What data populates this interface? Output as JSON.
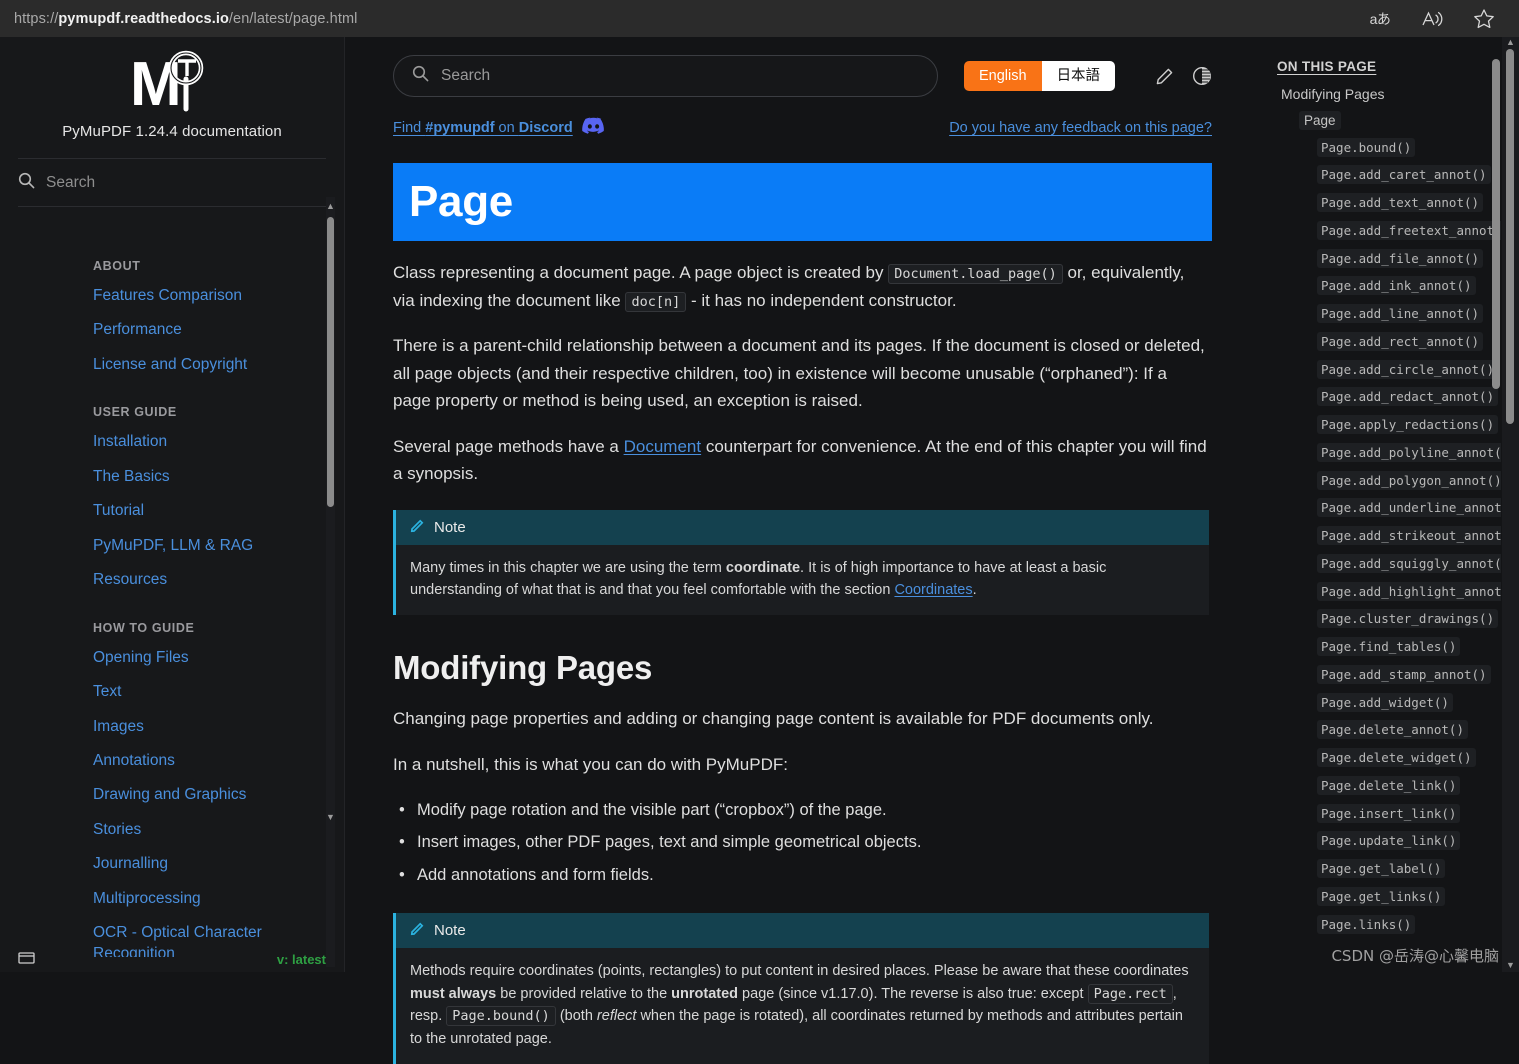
{
  "browser": {
    "url_scheme": "https://",
    "url_host": "pymupdf.readthedocs.io",
    "url_path": "/en/latest/page.html",
    "icons": {
      "translate": "translate-icon",
      "read_aloud": "read-aloud-icon",
      "favorite": "favorite-star-icon"
    }
  },
  "sidebar": {
    "brand_title": "PyMuPDF 1.24.4 documentation",
    "search_placeholder": "Search",
    "sections": [
      {
        "caption": "ABOUT",
        "links": [
          "Features Comparison",
          "Performance",
          "License and Copyright"
        ]
      },
      {
        "caption": "USER GUIDE",
        "links": [
          "Installation",
          "The Basics",
          "Tutorial",
          "PyMuPDF, LLM & RAG",
          "Resources"
        ]
      },
      {
        "caption": "HOW TO GUIDE",
        "links": [
          "Opening Files",
          "Text",
          "Images",
          "Annotations",
          "Drawing and Graphics",
          "Stories",
          "Journalling",
          "Multiprocessing",
          "OCR - Optical Character Recognition"
        ]
      }
    ],
    "version_label": "v: latest"
  },
  "topbar": {
    "search_placeholder": "Search",
    "lang_en": "English",
    "lang_jp": "日本語",
    "edit_icon": "pencil-edit-icon",
    "theme_icon": "contrast-theme-toggle-icon"
  },
  "subbar": {
    "discord_prefix": "Find ",
    "discord_tag": "#pymupdf",
    "discord_mid": " on ",
    "discord_name": "Discord",
    "feedback": "Do you have any feedback on this page?"
  },
  "content": {
    "hero_title": "Page",
    "p1_a": "Class representing a document page. A page object is created by ",
    "p1_code1": "Document.load_page()",
    "p1_b": " or, equivalently, via indexing the document like ",
    "p1_code2": "doc[n]",
    "p1_c": " - it has no independent constructor.",
    "p2": "There is a parent-child relationship between a document and its pages. If the document is closed or deleted, all page objects (and their respective children, too) in existence will become unusable (“orphaned”): If a page property or method is being used, an exception is raised.",
    "p3_a": "Several page methods have a ",
    "p3_link": "Document",
    "p3_b": " counterpart for convenience. At the end of this chapter you will find a synopsis.",
    "note1": {
      "label": "Note",
      "text_a": "Many times in this chapter we are using the term ",
      "bold1": "coordinate",
      "text_b": ". It is of high importance to have at least a basic understanding of what that is and that you feel comfortable with the section ",
      "link": "Coordinates",
      "text_c": "."
    },
    "section_heading": "Modifying Pages",
    "p4": "Changing page properties and adding or changing page content is available for PDF documents only.",
    "p5": "In a nutshell, this is what you can do with PyMuPDF:",
    "bullets": [
      "Modify page rotation and the visible part (“cropbox”) of the page.",
      "Insert images, other PDF pages, text and simple geometrical objects.",
      "Add annotations and form fields."
    ],
    "note2": {
      "label": "Note",
      "text_a": "Methods require coordinates (points, rectangles) to put content in desired places. Please be aware that these coordinates ",
      "bold1": "must always",
      "text_b": " be provided relative to the ",
      "bold2": "unrotated",
      "text_c": " page (since v1.17.0). The reverse is also true: except ",
      "code1": "Page.rect",
      "text_d": ", resp. ",
      "code2": "Page.bound()",
      "text_e": " (both ",
      "italic1": "reflect",
      "text_f": " when the page is rotated), all coordinates returned by methods and attributes pertain to the unrotated page."
    }
  },
  "toc": {
    "title": "ON THIS PAGE",
    "level1": "Modifying Pages",
    "level2": "Page",
    "items": [
      "Page.bound()",
      "Page.add_caret_annot()",
      "Page.add_text_annot()",
      "Page.add_freetext_annot()",
      "Page.add_file_annot()",
      "Page.add_ink_annot()",
      "Page.add_line_annot()",
      "Page.add_rect_annot()",
      "Page.add_circle_annot()",
      "Page.add_redact_annot()",
      "Page.apply_redactions()",
      "Page.add_polyline_annot()",
      "Page.add_polygon_annot()",
      "Page.add_underline_annot()",
      "Page.add_strikeout_annot()",
      "Page.add_squiggly_annot()",
      "Page.add_highlight_annot()",
      "Page.cluster_drawings()",
      "Page.find_tables()",
      "Page.add_stamp_annot()",
      "Page.add_widget()",
      "Page.delete_annot()",
      "Page.delete_widget()",
      "Page.delete_link()",
      "Page.insert_link()",
      "Page.update_link()",
      "Page.get_label()",
      "Page.get_links()",
      "Page.links()"
    ]
  },
  "watermark": "CSDN @岳涛@心馨电脑",
  "colors": {
    "accent_blue": "#0a7cf7",
    "link_blue": "#4a8fdd",
    "orange": "#f97316",
    "note_header": "#14414f",
    "note_border": "#2bb3e0",
    "green": "#2ea043",
    "discord_purple": "#5865f2"
  }
}
